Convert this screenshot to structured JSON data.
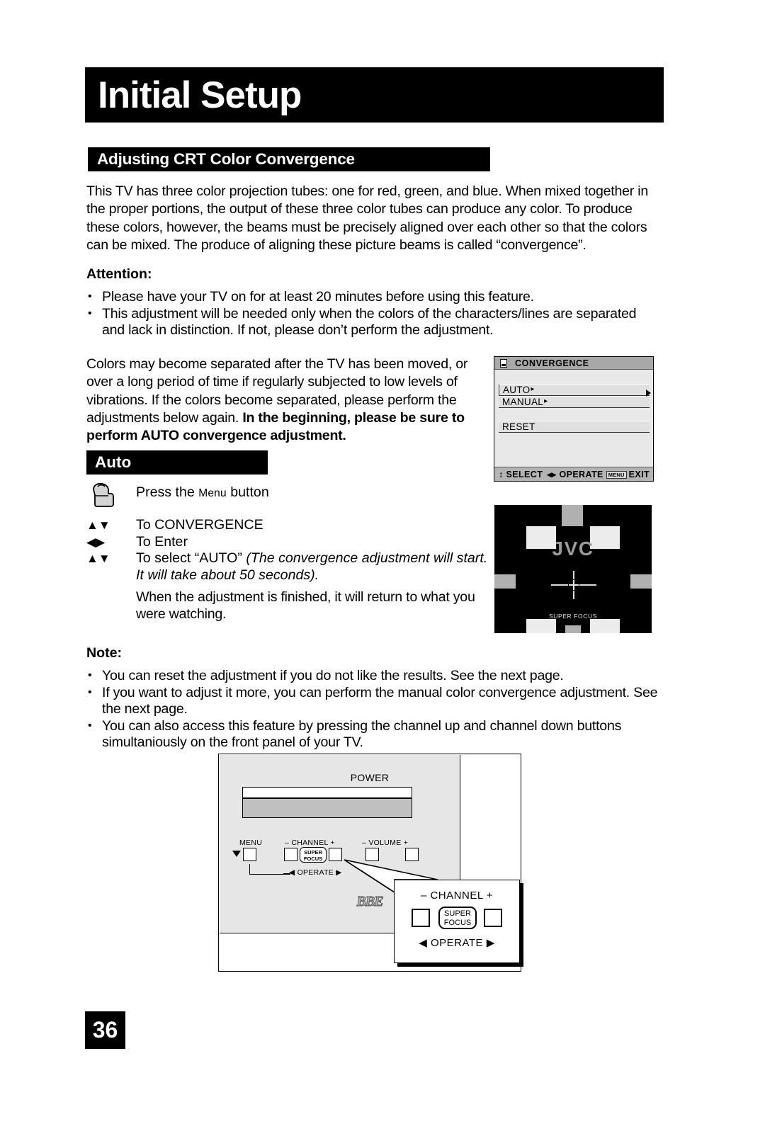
{
  "page": {
    "banner_title": "Initial Setup",
    "section_title": "Adjusting CRT Color Convergence",
    "page_number": "36"
  },
  "intro": {
    "paragraph": "This TV has three color projection tubes: one for red, green, and blue. When mixed together in the proper portions, the output of these three color tubes can produce any color. To produce these colors, however, the beams must be precisely aligned over each other so that the colors can be mixed. The produce of aligning these picture beams is called “convergence”."
  },
  "attention": {
    "heading": "Attention:",
    "items": [
      "Please have your TV on for at least 20 minutes before using this feature.",
      "This adjustment will be needed only when the colors of the characters/lines are separated and lack in distinction. If not, please don’t perform the adjustment."
    ],
    "bullet": "•"
  },
  "moved": {
    "normal_text": "Colors may become separated after the TV has been moved, or over a long period of time if regularly subjected to low levels of vibrations. If the colors become separated, please perform the adjustments below again. ",
    "bold_text": "In the beginning, please be sure to perform AUTO convergence adjustment."
  },
  "auto_section": {
    "heading": "Auto",
    "hand_step": {
      "prefix": "Press the ",
      "smallcap": "Menu",
      "suffix": " button"
    },
    "steps": [
      {
        "arrows": "▲▼",
        "text": "To CONVERGENCE",
        "italic": ""
      },
      {
        "arrows": "◀▶",
        "text": "To Enter",
        "italic": ""
      },
      {
        "arrows": "▲▼",
        "text": "To select “AUTO”  ",
        "italic": "(The convergence adjustment will start. It will take about 50 seconds)."
      }
    ],
    "finish_note": "When the adjustment is finished, it will return to what you were watching."
  },
  "note": {
    "heading": "Note:",
    "items": [
      "You can reset the adjustment if you do not like the results. See the next page.",
      "If you want to adjust it more, you can perform the manual color convergence adjustment. See the next page.",
      "You can also access this feature by pressing the channel up and channel down buttons simultaniously on the front panel of your TV."
    ],
    "bullet": "•"
  },
  "osd_menu": {
    "title": "CONVERGENCE",
    "icon": "tv-icon",
    "items": [
      {
        "label": "AUTO",
        "caret": "▸"
      },
      {
        "label": "MANUAL",
        "caret": "▸"
      },
      {
        "label": "RESET",
        "caret": ""
      }
    ],
    "footer": {
      "select": "↕ SELECT",
      "operate": "◂▸ OPERATE",
      "menu_chip": "MENU",
      "exit": "EXIT"
    }
  },
  "test_pattern": {
    "logo": "JVC",
    "caption": "SUPER FOCUS"
  },
  "front_panel": {
    "power_label": "POWER",
    "menu_label": "MENU",
    "channel_label": "–  CHANNEL  +",
    "volume_label": "–  VOLUME  +",
    "super_focus_line1": "SUPER",
    "super_focus_line2": "FOCUS",
    "operate_label": "◀ OPERATE ▶",
    "brand_logo": "BBE"
  },
  "callout": {
    "channel_label": "–  CHANNEL  +",
    "super_focus_line1": "SUPER",
    "super_focus_line2": "FOCUS",
    "operate_label": "◀ OPERATE ▶"
  },
  "colors": {
    "banner_bg": "#000000",
    "banner_text": "#ffffff",
    "osd_bg": "#e8e8e8",
    "osd_titlebar": "#a8a8a8",
    "osd_footer": "#b4b4b4",
    "pattern_bg": "#000000",
    "pattern_light": "#ececec",
    "pattern_gray": "#b0b0b0",
    "panel_face": "#e6e6e6"
  }
}
